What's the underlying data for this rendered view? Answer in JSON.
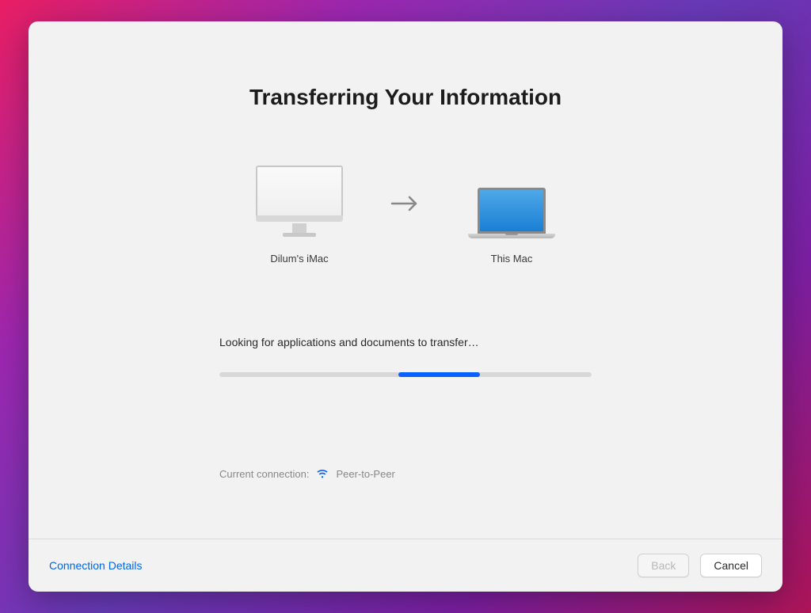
{
  "title": "Transferring Your Information",
  "devices": {
    "source": {
      "label": "Dilum's iMac"
    },
    "arrow_icon": "arrow-right-icon",
    "target": {
      "label": "This Mac"
    }
  },
  "progress": {
    "status_text": "Looking for applications and documents to transfer…",
    "bar_left_pct": "48",
    "bar_width_pct": "22"
  },
  "connection": {
    "label": "Current connection:",
    "icon": "wifi-icon",
    "type": "Peer-to-Peer"
  },
  "footer": {
    "connection_details": "Connection Details",
    "back": "Back",
    "cancel": "Cancel"
  }
}
